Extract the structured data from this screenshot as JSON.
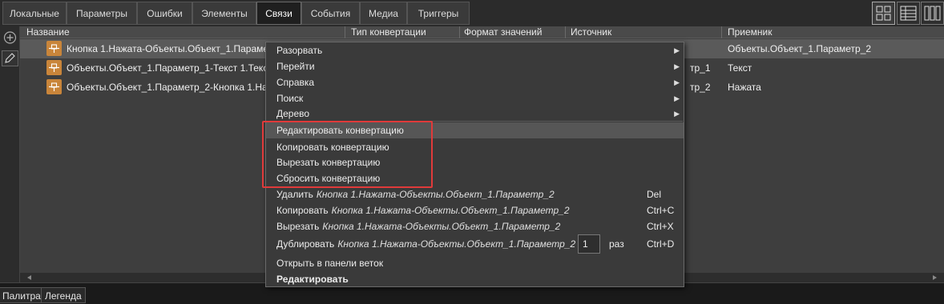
{
  "tabs": [
    {
      "label": "Локальные"
    },
    {
      "label": "Параметры"
    },
    {
      "label": "Ошибки"
    },
    {
      "label": "Элементы"
    },
    {
      "label": "Связи"
    },
    {
      "label": "События"
    },
    {
      "label": "Медиа"
    },
    {
      "label": "Триггеры"
    }
  ],
  "active_tab": "Связи",
  "view_modes": [
    "grid-view-icon",
    "table-view-icon",
    "columns-view-icon"
  ],
  "grid": {
    "columns": [
      "Название",
      "Тип конвертации",
      "Формат значений",
      "Источник",
      "Приемник"
    ],
    "rows": [
      {
        "name": "Кнопка 1.Нажата-Объекты.Объект_1.Параме",
        "source": "",
        "target": "Объекты.Объект_1.Параметр_2",
        "selected": true
      },
      {
        "name": "Объекты.Объект_1.Параметр_1-Текст 1.Текст",
        "source": "тр_1",
        "target": "Текст",
        "selected": false
      },
      {
        "name": "Объекты.Объект_1.Параметр_2-Кнопка 1.На",
        "source": "тр_2",
        "target": "Нажата",
        "selected": false
      }
    ]
  },
  "bottom_tabs": [
    {
      "label": "Палитра"
    },
    {
      "label": "Легенда"
    }
  ],
  "context_menu": {
    "submenus": [
      {
        "label": "Разорвать"
      },
      {
        "label": "Перейти"
      },
      {
        "label": "Справка"
      },
      {
        "label": "Поиск"
      },
      {
        "label": "Дерево"
      }
    ],
    "conversion": [
      {
        "label": "Редактировать конвертацию",
        "highlighted": true
      },
      {
        "label": "Копировать конвертацию"
      },
      {
        "label": "Вырезать конвертацию"
      },
      {
        "label": "Сбросить конвертацию"
      }
    ],
    "actions": [
      {
        "label": "Удалить",
        "target": "Кнопка 1.Нажата-Объекты.Объект_1.Параметр_2",
        "shortcut": "Del"
      },
      {
        "label": "Копировать",
        "target": "Кнопка 1.Нажата-Объекты.Объект_1.Параметр_2",
        "shortcut": "Ctrl+C"
      },
      {
        "label": "Вырезать",
        "target": "Кнопка 1.Нажата-Объекты.Объект_1.Параметр_2",
        "shortcut": "Ctrl+X"
      },
      {
        "label": "Дублировать",
        "target": "Кнопка 1.Нажата-Объекты.Объект_1.Параметр_2",
        "shortcut": "Ctrl+D",
        "count": "1",
        "count_unit": "раз"
      },
      {
        "label": "Открыть в панели веток"
      },
      {
        "label": "Редактировать",
        "bold": true
      }
    ]
  }
}
